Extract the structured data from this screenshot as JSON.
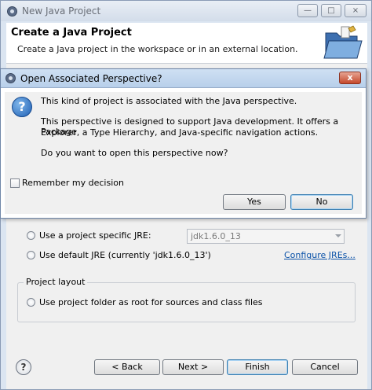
{
  "wizard": {
    "window_title": "New Java Project",
    "window_controls": {
      "minimize": "—",
      "maximize": "□",
      "close": "×"
    },
    "header_title": "Create a Java Project",
    "header_description": "Create a Java project in the workspace or in an external location.",
    "jre": {
      "specific_label": "Use a project specific JRE:",
      "specific_value": "jdk1.6.0_13",
      "default_label": "Use default JRE (currently 'jdk1.6.0_13')",
      "configure_link": "Configure JREs..."
    },
    "layout_group": {
      "label": "Project layout",
      "option": "Use project folder as root for sources and class files"
    },
    "buttons": {
      "help": "?",
      "back": "< Back",
      "next": "Next >",
      "finish": "Finish",
      "cancel": "Cancel"
    }
  },
  "dialog": {
    "title": "Open Associated Perspective?",
    "close": "x",
    "icon": "question-icon",
    "message_1": "This kind of project is associated with the Java perspective.",
    "message_2a": "This perspective is designed to support Java development. It offers a Package",
    "message_2b": "Explorer, a Type Hierarchy, and Java-specific navigation actions.",
    "message_3": "Do you want to open this perspective now?",
    "remember_label": "Remember my decision",
    "yes": "Yes",
    "no": "No"
  }
}
